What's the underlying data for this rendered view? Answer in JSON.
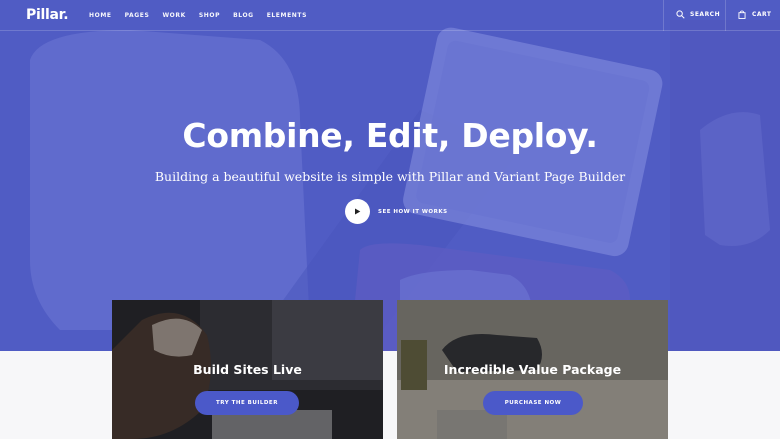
{
  "brand": {
    "logo": "Pillar."
  },
  "nav": {
    "items": [
      "HOME",
      "PAGES",
      "WORK",
      "SHOP",
      "BLOG",
      "ELEMENTS"
    ],
    "search_label": "SEARCH",
    "cart_label": "CART"
  },
  "hero": {
    "headline": "Combine, Edit, Deploy.",
    "subheadline": "Building a beautiful website is simple with Pillar and Variant Page Builder",
    "video_label": "SEE HOW IT WORKS"
  },
  "cards": [
    {
      "title": "Build Sites Live",
      "button": "TRY THE BUILDER"
    },
    {
      "title": "Incredible Value Package",
      "button": "PURCHASE NOW"
    }
  ],
  "colors": {
    "hero_overlay": "#5d68c8",
    "accent": "#4b59c9",
    "page_bg": "#f7f7f9"
  },
  "icons": {
    "search": "search-icon",
    "cart": "bag-icon",
    "play": "play-icon"
  }
}
